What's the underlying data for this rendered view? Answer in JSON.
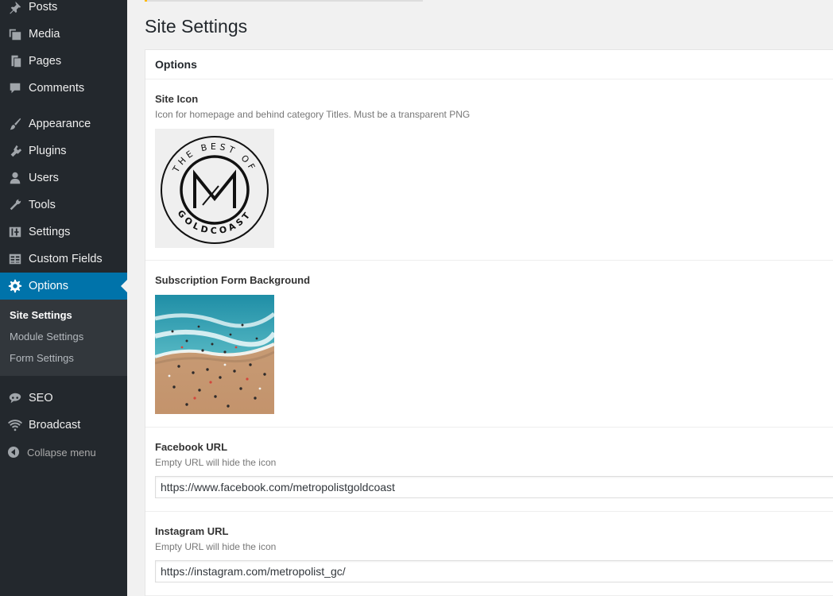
{
  "sidebar": {
    "items": [
      {
        "label": "Posts",
        "icon": "pin-icon"
      },
      {
        "label": "Media",
        "icon": "media-icon"
      },
      {
        "label": "Pages",
        "icon": "pages-icon"
      },
      {
        "label": "Comments",
        "icon": "comment-icon"
      },
      {
        "label": "Appearance",
        "icon": "brush-icon"
      },
      {
        "label": "Plugins",
        "icon": "plug-icon"
      },
      {
        "label": "Users",
        "icon": "user-icon"
      },
      {
        "label": "Tools",
        "icon": "wrench-icon"
      },
      {
        "label": "Settings",
        "icon": "sliders-icon"
      },
      {
        "label": "Custom Fields",
        "icon": "table-icon"
      },
      {
        "label": "Options",
        "icon": "gear-icon"
      },
      {
        "label": "SEO",
        "icon": "seo-icon"
      },
      {
        "label": "Broadcast",
        "icon": "wifi-icon"
      }
    ],
    "submenu": [
      "Site Settings",
      "Module Settings",
      "Form Settings"
    ],
    "collapse_label": "Collapse menu"
  },
  "page_title": "Site Settings",
  "panel": {
    "title": "Options",
    "site_icon": {
      "label": "Site Icon",
      "desc": "Icon for homepage and behind category Titles. Must be a transparent PNG",
      "logo_top_text": "THE BEST OF",
      "logo_bottom_text": "GOLDCOAST"
    },
    "subscription": {
      "label": "Subscription Form Background"
    },
    "facebook": {
      "label": "Facebook URL",
      "desc": "Empty URL will hide the icon",
      "value": "https://www.facebook.com/metropolistgoldcoast"
    },
    "instagram": {
      "label": "Instagram URL",
      "desc": "Empty URL will hide the icon",
      "value": "https://instagram.com/metropolist_gc/"
    }
  },
  "colors": {
    "sidebar_bg": "#23282d",
    "active_bg": "#0073aa",
    "submenu_bg": "#32373c",
    "notice_accent": "#ffb900"
  }
}
